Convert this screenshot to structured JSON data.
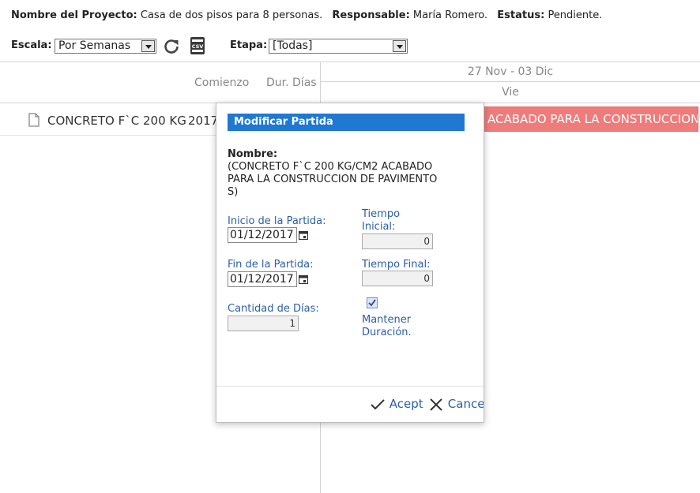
{
  "project": {
    "name_label": "Nombre del Proyecto:",
    "name_value": "Casa de dos pisos para 8 personas.",
    "responsible_label": "Responsable:",
    "responsible_value": "María Romero.",
    "status_label": "Estatus:",
    "status_value": "Pendiente."
  },
  "toolbar": {
    "scale_label": "Escala:",
    "scale_value": "Por Semanas",
    "stage_label": "Etapa:",
    "stage_value": "[Todas]",
    "refresh_icon": "refresh-icon",
    "csv_icon": "csv-icon",
    "csv_text": "CSV"
  },
  "grid": {
    "col_start": "Comienzo",
    "col_duration": "Dur. Días",
    "week_range": "27 Nov - 03 Dic",
    "day": "Vie",
    "row_name": "CONCRETO F`C 200 KG",
    "row_year": "2017",
    "bar_text": "ACABADO PARA LA CONSTRUCCION DE"
  },
  "dialog": {
    "title": "Modificar Partida",
    "name_label": "Nombre:",
    "name_value": "(CONCRETO F`C 200 KG/CM2 ACABADO PARA LA CONSTRUCCION DE PAVIMENTOS)",
    "start_label": "Inicio de la Partida:",
    "start_value": "01/12/2017",
    "initial_time_label": "Tiempo Inicial:",
    "initial_time_value": "0",
    "end_label": "Fin de la Partida:",
    "end_value": "01/12/2017",
    "final_time_label": "Tiempo Final:",
    "final_time_value": "0",
    "days_label": "Cantidad de Días:",
    "days_value": "1",
    "keep_duration_label": "Mantener Duración.",
    "keep_duration_checked": true,
    "accept_label": "Acept",
    "cancel_label": "Cance"
  },
  "colors": {
    "accent": "#1f78d1",
    "bar": "#ef7b7b",
    "link": "#2a5ea8"
  }
}
